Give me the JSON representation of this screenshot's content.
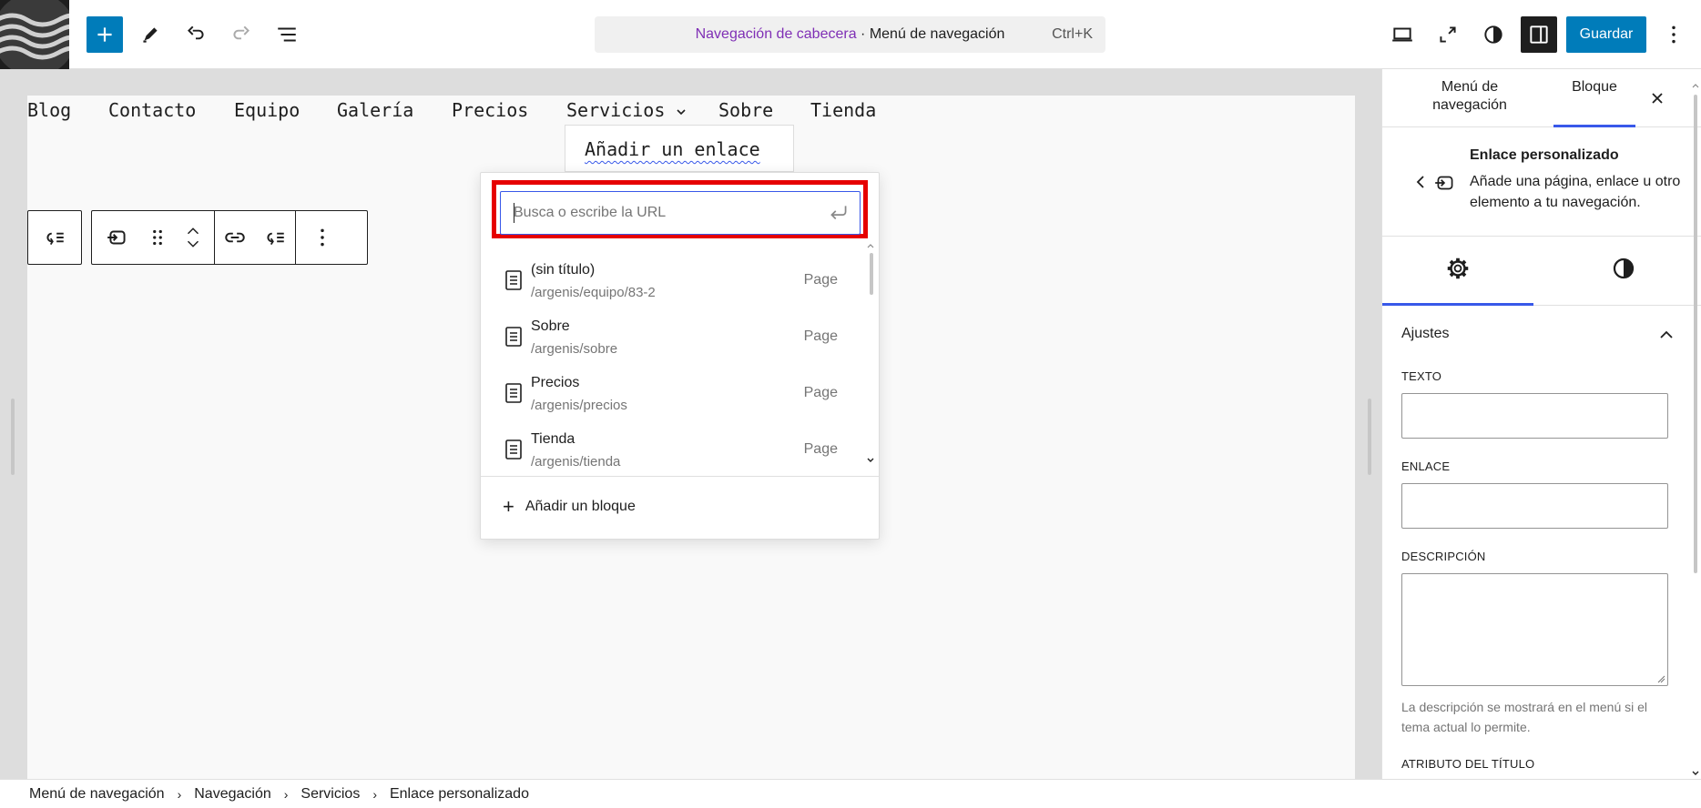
{
  "topbar": {
    "logo_icon": "wave-logo-icon",
    "add_icon": "plus-icon",
    "tools_icon": "pencil-icon",
    "undo_icon": "undo-icon",
    "redo_icon": "redo-icon",
    "outline_icon": "list-view-icon",
    "command": {
      "primary": "Navegación de cabecera",
      "separator": " · ",
      "secondary": "Menú de navegación",
      "shortcut": "Ctrl+K"
    },
    "device_icon": "desktop-icon",
    "fullscreen_icon": "fullscreen-icon",
    "styles_icon": "half-circle-icon",
    "sidebar_icon": "sidebar-icon",
    "save_label": "Guardar",
    "options_icon": "more-vertical-icon",
    "accent_color": "#007cba"
  },
  "canvas": {
    "nav_items": [
      "Blog",
      "Contacto",
      "Equipo",
      "Galería",
      "Precios",
      "Servicios",
      "Sobre",
      "Tienda"
    ],
    "submenu_item": "Añadir un enlace"
  },
  "popover": {
    "search_placeholder": "Busca o escribe la URL",
    "results": [
      {
        "title": "(sin título)",
        "url": "/argenis/equipo/83-2",
        "type": "Page"
      },
      {
        "title": "Sobre",
        "url": "/argenis/sobre",
        "type": "Page"
      },
      {
        "title": "Precios",
        "url": "/argenis/precios",
        "type": "Page"
      },
      {
        "title": "Tienda",
        "url": "/argenis/tienda",
        "type": "Page"
      }
    ],
    "add_block_label": "Añadir un bloque",
    "highlight_color": "#e60000"
  },
  "sidebar": {
    "tab_menu": "Menú de navegación",
    "tab_block": "Bloque",
    "block_title": "Enlace personalizado",
    "block_description": "Añade una página, enlace u otro elemento a tu navegación.",
    "panel_title": "Ajustes",
    "fields": {
      "text_label": "TEXTO",
      "link_label": "ENLACE",
      "description_label": "DESCRIPCIÓN",
      "description_hint": "La descripción se mostrará en el menú si el tema actual lo permite.",
      "title_attr_label": "ATRIBUTO DEL TÍTULO"
    }
  },
  "breadcrumb": [
    "Menú de navegación",
    "Navegación",
    "Servicios",
    "Enlace personalizado"
  ]
}
